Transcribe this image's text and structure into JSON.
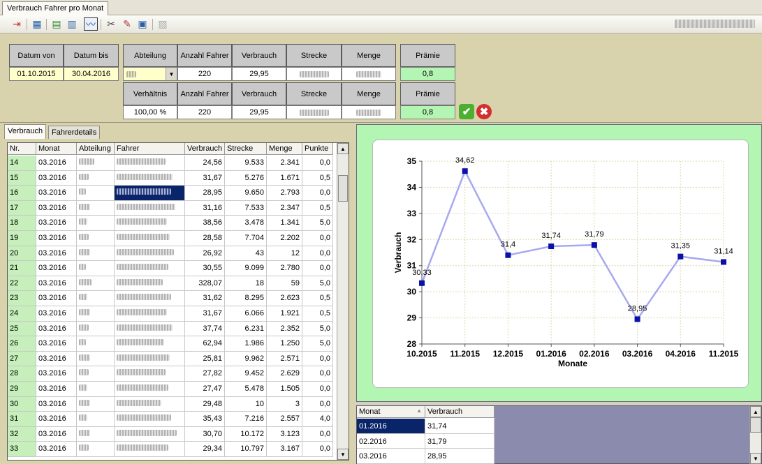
{
  "window": {
    "tab_title": "Verbrauch Fahrer pro Monat"
  },
  "filter": {
    "headers_row1": [
      "Datum von",
      "Datum bis",
      "Abteilung",
      "Anzahl Fahrer",
      "Verbrauch",
      "Strecke",
      "Menge",
      "Prämie"
    ],
    "headers_row2": [
      "Verhältnis",
      "Anzahl Fahrer",
      "Verbrauch",
      "Strecke",
      "Menge",
      "Prämie"
    ],
    "datum_von": "01.10.2015",
    "datum_bis": "30.04.2016",
    "abteilung_value": "",
    "row1": {
      "anzahl_fahrer": "220",
      "verbrauch": "29,95",
      "praemie": "0,8"
    },
    "row2": {
      "verhaeltnis": "100,00 %",
      "anzahl_fahrer": "220",
      "verbrauch": "29,95",
      "praemie": "0,8"
    }
  },
  "subtabs": [
    "Verbrauch",
    "Fahrerdetails"
  ],
  "grid": {
    "columns": [
      "Nr.",
      "Monat",
      "Abteilung",
      "Fahrer",
      "Verbrauch",
      "Strecke",
      "Menge",
      "Punkte"
    ],
    "rows": [
      {
        "nr": "14",
        "monat": "03.2016",
        "verbrauch": "24,56",
        "strecke": "9.533",
        "menge": "2.341",
        "punkte": "0,0"
      },
      {
        "nr": "15",
        "monat": "03.2016",
        "verbrauch": "31,67",
        "strecke": "5.276",
        "menge": "1.671",
        "punkte": "0,5"
      },
      {
        "nr": "16",
        "monat": "03.2016",
        "verbrauch": "28,95",
        "strecke": "9.650",
        "menge": "2.793",
        "punkte": "0,0"
      },
      {
        "nr": "17",
        "monat": "03.2016",
        "verbrauch": "31,16",
        "strecke": "7.533",
        "menge": "2.347",
        "punkte": "0,5"
      },
      {
        "nr": "18",
        "monat": "03.2016",
        "verbrauch": "38,56",
        "strecke": "3.478",
        "menge": "1.341",
        "punkte": "5,0"
      },
      {
        "nr": "19",
        "monat": "03.2016",
        "verbrauch": "28,58",
        "strecke": "7.704",
        "menge": "2.202",
        "punkte": "0,0"
      },
      {
        "nr": "20",
        "monat": "03.2016",
        "verbrauch": "26,92",
        "strecke": "43",
        "menge": "12",
        "punkte": "0,0"
      },
      {
        "nr": "21",
        "monat": "03.2016",
        "verbrauch": "30,55",
        "strecke": "9.099",
        "menge": "2.780",
        "punkte": "0,0"
      },
      {
        "nr": "22",
        "monat": "03.2016",
        "verbrauch": "328,07",
        "strecke": "18",
        "menge": "59",
        "punkte": "5,0"
      },
      {
        "nr": "23",
        "monat": "03.2016",
        "verbrauch": "31,62",
        "strecke": "8.295",
        "menge": "2.623",
        "punkte": "0,5"
      },
      {
        "nr": "24",
        "monat": "03.2016",
        "verbrauch": "31,67",
        "strecke": "6.066",
        "menge": "1.921",
        "punkte": "0,5"
      },
      {
        "nr": "25",
        "monat": "03.2016",
        "verbrauch": "37,74",
        "strecke": "6.231",
        "menge": "2.352",
        "punkte": "5,0"
      },
      {
        "nr": "26",
        "monat": "03.2016",
        "verbrauch": "62,94",
        "strecke": "1.986",
        "menge": "1.250",
        "punkte": "5,0"
      },
      {
        "nr": "27",
        "monat": "03.2016",
        "verbrauch": "25,81",
        "strecke": "9.962",
        "menge": "2.571",
        "punkte": "0,0"
      },
      {
        "nr": "28",
        "monat": "03.2016",
        "verbrauch": "27,82",
        "strecke": "9.452",
        "menge": "2.629",
        "punkte": "0,0"
      },
      {
        "nr": "29",
        "monat": "03.2016",
        "verbrauch": "27,47",
        "strecke": "5.478",
        "menge": "1.505",
        "punkte": "0,0"
      },
      {
        "nr": "30",
        "monat": "03.2016",
        "verbrauch": "29,48",
        "strecke": "10",
        "menge": "3",
        "punkte": "0,0"
      },
      {
        "nr": "31",
        "monat": "03.2016",
        "verbrauch": "35,43",
        "strecke": "7.216",
        "menge": "2.557",
        "punkte": "4,0"
      },
      {
        "nr": "32",
        "monat": "03.2016",
        "verbrauch": "30,70",
        "strecke": "10.172",
        "menge": "3.123",
        "punkte": "0,0"
      },
      {
        "nr": "33",
        "monat": "03.2016",
        "verbrauch": "29,34",
        "strecke": "10.797",
        "menge": "3.167",
        "punkte": "0,0"
      }
    ]
  },
  "chart_data": {
    "type": "line",
    "categories": [
      "10.2015",
      "11.2015",
      "12.2015",
      "01.2016",
      "02.2016",
      "03.2016",
      "04.2016",
      "11.2015"
    ],
    "values": [
      30.33,
      34.62,
      31.4,
      31.74,
      31.79,
      28.95,
      31.35,
      31.14
    ],
    "data_labels": [
      "30,33",
      "34,62",
      "31,4",
      "31,74",
      "31,79",
      "28,95",
      "31,35",
      "31,14"
    ],
    "xlabel": "Monate",
    "ylabel": "Verbrauch",
    "ylim": [
      28,
      35
    ],
    "yticks": [
      28,
      29,
      30,
      31,
      32,
      33,
      34,
      35
    ],
    "grid": true,
    "line_color": "#a7a9ef",
    "marker_color": "#0a10a8"
  },
  "summary_table": {
    "columns": [
      "Monat",
      "Verbrauch"
    ],
    "rows": [
      {
        "monat": "01.2016",
        "verbrauch": "31,74"
      },
      {
        "monat": "02.2016",
        "verbrauch": "31,79"
      },
      {
        "monat": "03.2016",
        "verbrauch": "28,95"
      }
    ]
  }
}
